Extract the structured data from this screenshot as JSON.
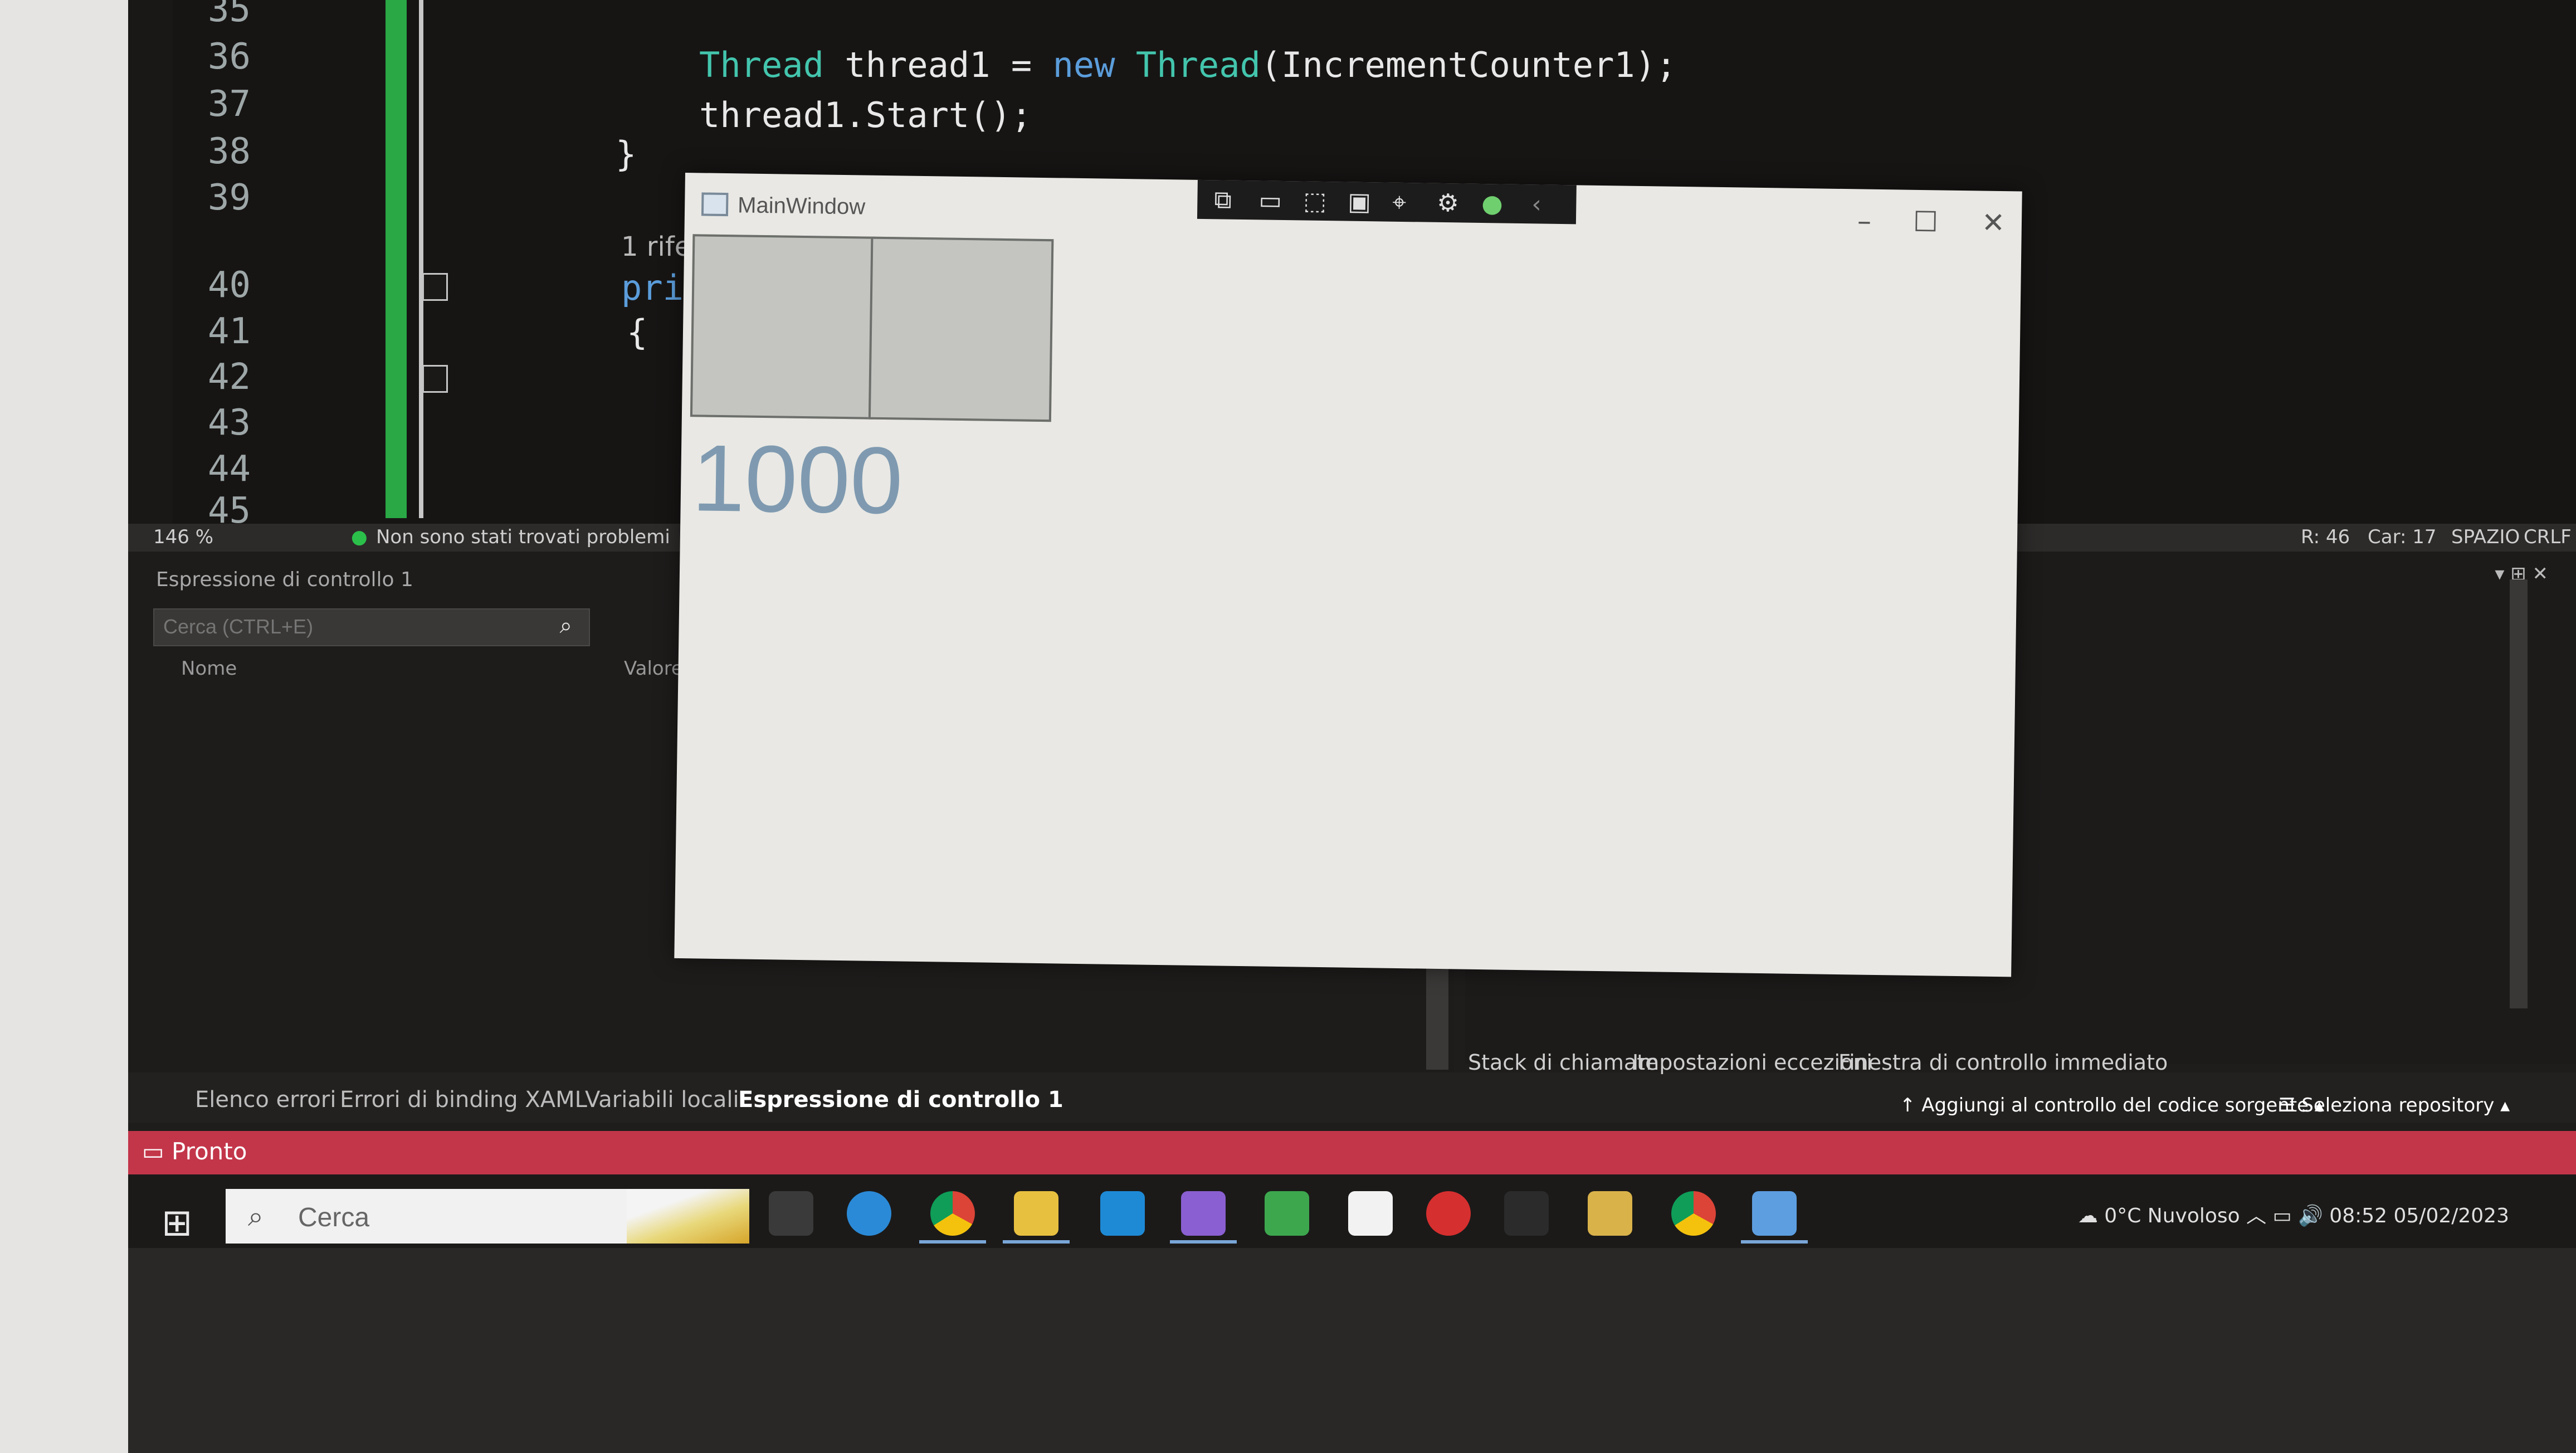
{
  "editor": {
    "line_numbers": [
      "35",
      "36",
      "37",
      "38",
      "39",
      "40",
      "41",
      "42",
      "43",
      "44",
      "45"
    ],
    "code_lines": [
      {
        "type": "Thread",
        "var": " thread1 = ",
        "kw": "new",
        "rest": " Thread",
        "args": "(IncrementCounter1);"
      },
      {
        "text": "thread1.Start();"
      },
      {
        "text": "}"
      }
    ],
    "ref_label": "1 rife",
    "keyword_fragment": "pri",
    "brace": "{"
  },
  "editor_status": {
    "zoom": "146 %",
    "issues": "Non sono stati trovati problemi",
    "position": "R: 46",
    "col": "Car: 17",
    "spacing": "SPAZIO",
    "eol": "CRLF"
  },
  "watch_panel": {
    "title": "Espressione di controllo 1",
    "search_placeholder": "Cerca (CTRL+E)",
    "col_name": "Nome",
    "col_value": "Valore"
  },
  "bottom_tabs": {
    "left": [
      "Elenco errori",
      "Errori di binding XAML",
      "Variabili locali",
      "Espressione di controllo 1"
    ],
    "right": [
      "Stack di chiamate",
      "Impostazioni eccezioni",
      "Finestra di controllo immediato"
    ]
  },
  "status_bar": {
    "text": "Pronto",
    "source_control": "Aggiungi al controllo del codice sorgente",
    "repo": "Seleziona repository"
  },
  "taskbar": {
    "search_placeholder": "Cerca",
    "weather": "0°C Nuvoloso",
    "time": "08:52",
    "date": "05/02/2023"
  },
  "main_window": {
    "title": "MainWindow",
    "counter": "1000"
  },
  "colors": {
    "accent_status": "#c3364a",
    "change_bar": "#29a845",
    "type_color": "#43c5ad",
    "keyword_color": "#5b9ddb"
  }
}
